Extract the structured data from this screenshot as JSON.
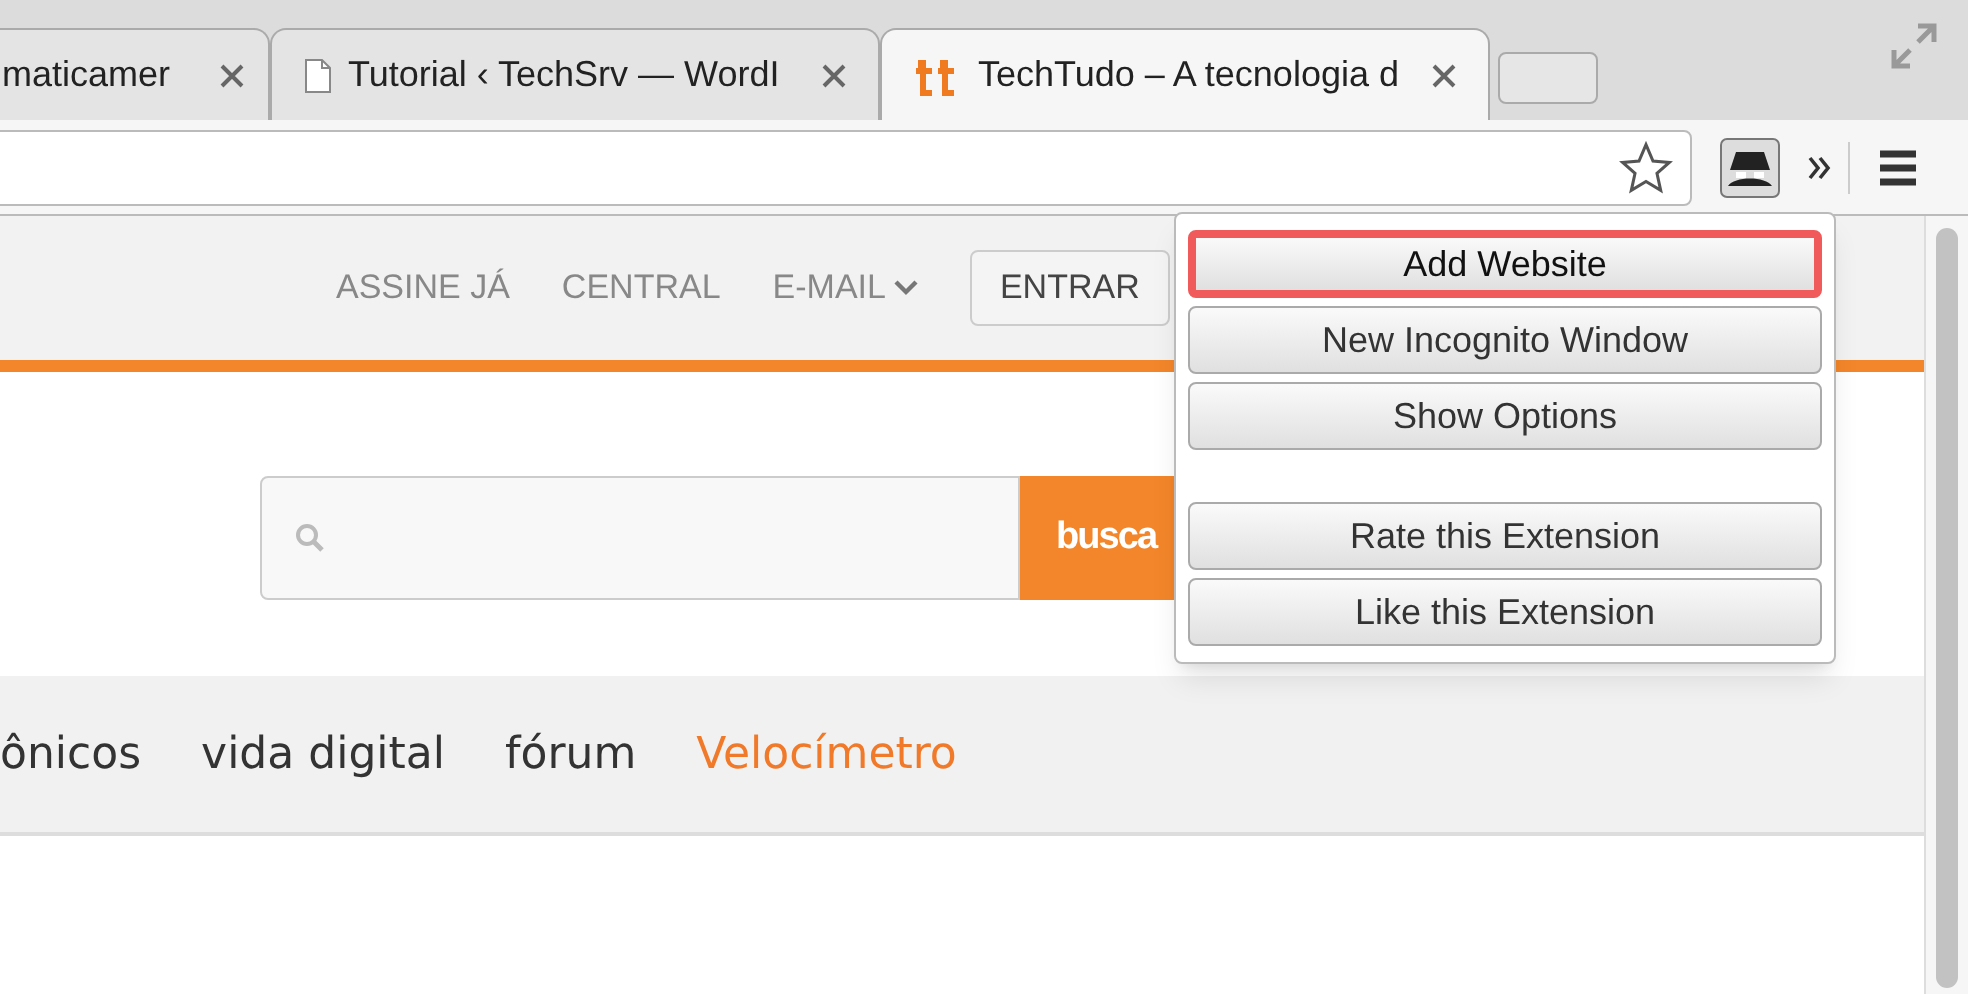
{
  "tabs": [
    {
      "title": "maticamer",
      "selected": false,
      "kind": "plain"
    },
    {
      "title": "Tutorial ‹ TechSrv — WordI",
      "selected": false,
      "kind": "page"
    },
    {
      "title": "TechTudo – A tecnologia d",
      "selected": true,
      "kind": "site"
    }
  ],
  "header_links": [
    {
      "label": "ASSINE JÁ",
      "dropdown": false
    },
    {
      "label": "CENTRAL",
      "dropdown": false
    },
    {
      "label": "E-MAIL",
      "dropdown": true
    }
  ],
  "login_button": "ENTRAR",
  "search": {
    "button": "busca"
  },
  "nav": [
    {
      "label": "ônicos",
      "selected": false
    },
    {
      "label": "vida digital",
      "selected": false
    },
    {
      "label": "fórum",
      "selected": false
    },
    {
      "label": "Velocímetro",
      "selected": true
    }
  ],
  "popup_groups": [
    [
      {
        "label": "Add Website",
        "highlighted": true
      },
      {
        "label": "New Incognito Window",
        "highlighted": false
      },
      {
        "label": "Show Options",
        "highlighted": false
      }
    ],
    [
      {
        "label": "Rate this Extension",
        "highlighted": false
      },
      {
        "label": "Like this Extension",
        "highlighted": false
      }
    ]
  ]
}
